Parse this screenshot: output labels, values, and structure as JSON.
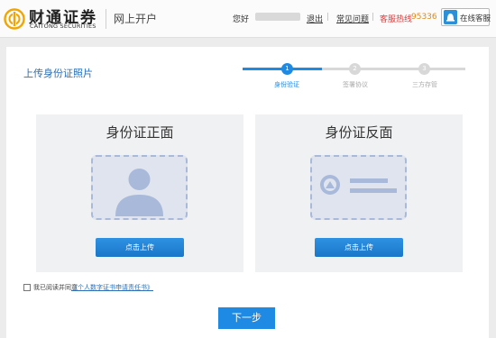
{
  "header": {
    "logo_cn": "财通证券",
    "logo_en": "CAITONG SECURITIES",
    "site_title": "网上开户",
    "greeting": "您好",
    "logout": "退出",
    "separator": "|",
    "faq": "常见问题",
    "hotline_label": "客服热线",
    "hotline_number": "95336",
    "online_service": "在线客服"
  },
  "main": {
    "title": "上传身份证照片",
    "steps": [
      {
        "number": "1",
        "label": "身份验证",
        "active": true
      },
      {
        "number": "2",
        "label": "签署协议",
        "active": false
      },
      {
        "number": "3",
        "label": "三方存管",
        "active": false
      }
    ],
    "front_panel": {
      "title": "身份证正面",
      "button": "点击上传"
    },
    "back_panel": {
      "title": "身份证反面",
      "button": "点击上传"
    },
    "agreement": {
      "text": "我已阅读并同意",
      "link": "《个人数字证书申请责任书》",
      "checked": false
    },
    "next_button": "下一步"
  },
  "colors": {
    "accent": "#1f8ae3",
    "title_blue": "#2a6fb8",
    "hotline_red": "#e23b3b",
    "hotline_orange": "#e08a17",
    "step_inactive": "#d8d8d8"
  },
  "icons": [
    "caitong-logo-icon",
    "customer-service-icon",
    "person-silhouette-icon",
    "national-emblem-icon"
  ]
}
